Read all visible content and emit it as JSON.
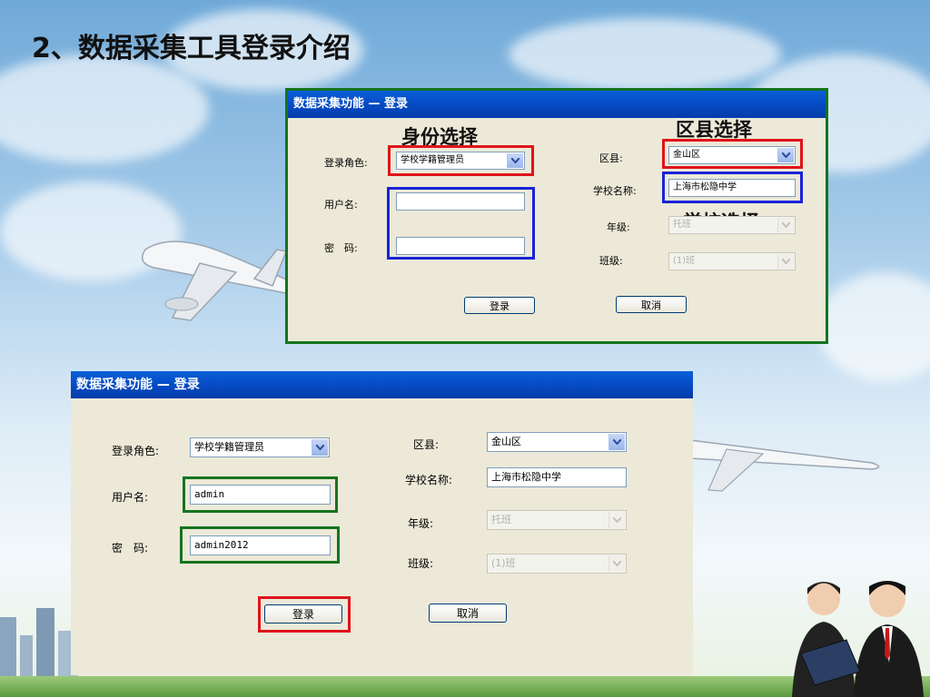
{
  "slide": {
    "title": "2、数据采集工具登录介绍"
  },
  "dialog_small": {
    "title": "数据采集功能 — 登录",
    "annotations": {
      "role": "身份选择",
      "district": "区县选择",
      "school": "学校选择"
    },
    "role_label": "登录角色:",
    "role_value": "学校学籍管理员",
    "username_label": "用户名:",
    "username_value": "",
    "password_label": "密　码:",
    "password_value": "",
    "district_label": "区县:",
    "district_value": "金山区",
    "school_label": "学校名称:",
    "school_value": "上海市松隐中学",
    "grade_label": "年级:",
    "grade_value": "托班",
    "class_label": "班级:",
    "class_value": "(1)班",
    "login_button": "登录",
    "cancel_button": "取消"
  },
  "dialog_large": {
    "title": "数据采集功能 — 登录",
    "role_label": "登录角色:",
    "role_value": "学校学籍管理员",
    "username_label": "用户名:",
    "username_value": "admin",
    "password_label": "密　码:",
    "password_value": "admin2012",
    "district_label": "区县:",
    "district_value": "金山区",
    "school_label": "学校名称:",
    "school_value": "上海市松隐中学",
    "grade_label": "年级:",
    "grade_value": "托班",
    "class_label": "班级:",
    "class_value": "(1)班",
    "login_button": "登录",
    "cancel_button": "取消"
  },
  "colors": {
    "highlight_red": "#e0141a",
    "highlight_blue": "#1a23d6",
    "highlight_green": "#14741e",
    "titlebar_blue": "#0548c0",
    "dialog_bg": "#ece9d8"
  }
}
